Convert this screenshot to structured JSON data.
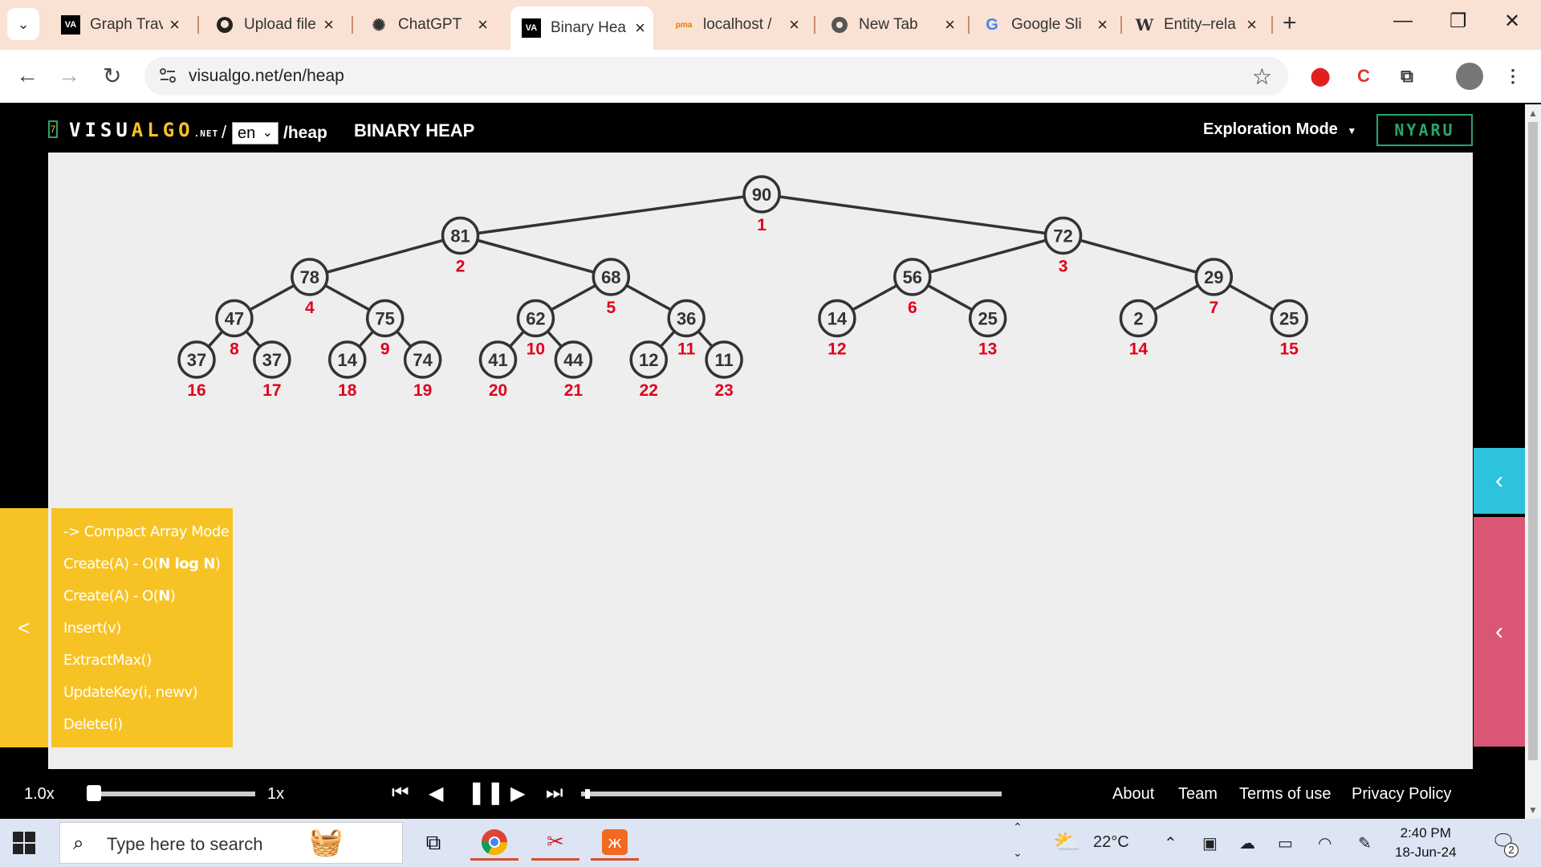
{
  "browser": {
    "tabs": [
      {
        "title": "Graph Trav",
        "icon": "VA"
      },
      {
        "title": "Upload file",
        "icon": "gh"
      },
      {
        "title": "ChatGPT",
        "icon": "@"
      },
      {
        "title": "Binary Hea",
        "icon": "VA",
        "active": true
      },
      {
        "title": "localhost /",
        "icon": "pma"
      },
      {
        "title": "New Tab",
        "icon": "o"
      },
      {
        "title": "Google Sli",
        "icon": "G"
      },
      {
        "title": "Entity–rela",
        "icon": "W"
      }
    ],
    "url": "visualgo.net/en/heap"
  },
  "header": {
    "logo_main": "VISU",
    "logo_algo": "ALGO",
    "logo_net": ".NET",
    "lang": "en",
    "path": "/heap",
    "title": "BINARY HEAP",
    "mode": "Exploration Mode",
    "login": "NYARU"
  },
  "heap": {
    "nodes": [
      90,
      81,
      72,
      78,
      68,
      56,
      29,
      47,
      75,
      62,
      36,
      14,
      25,
      2,
      25,
      37,
      37,
      14,
      74,
      41,
      44,
      12,
      11
    ]
  },
  "actions": {
    "items": [
      {
        "prefix": "-> Compact Array Mode",
        "bold": "",
        "suffix": ""
      },
      {
        "prefix": "Create(A) - O(",
        "bold": "N log N",
        "suffix": ")"
      },
      {
        "prefix": "Create(A) - O(",
        "bold": "N",
        "suffix": ")"
      },
      {
        "prefix": "Insert(v)",
        "bold": "",
        "suffix": ""
      },
      {
        "prefix": "ExtractMax()",
        "bold": "",
        "suffix": ""
      },
      {
        "prefix": "UpdateKey(i, newv)",
        "bold": "",
        "suffix": ""
      },
      {
        "prefix": "Delete(i)",
        "bold": "",
        "suffix": ""
      }
    ],
    "toggle": "<"
  },
  "controls": {
    "speed": "1.0x",
    "speed_max": "1x",
    "progress": 0.01
  },
  "footer": {
    "about": "About",
    "team": "Team",
    "terms": "Terms of use",
    "privacy": "Privacy Policy"
  },
  "taskbar": {
    "search_placeholder": "Type here to search",
    "temperature": "22°C",
    "time": "2:40 PM",
    "date": "18-Jun-24",
    "notifications": "2"
  },
  "colors": {
    "accent_yellow": "#f7c324",
    "accent_blue": "#2ec3dc",
    "accent_pink": "#d95775",
    "index_red": "#e0001b"
  }
}
